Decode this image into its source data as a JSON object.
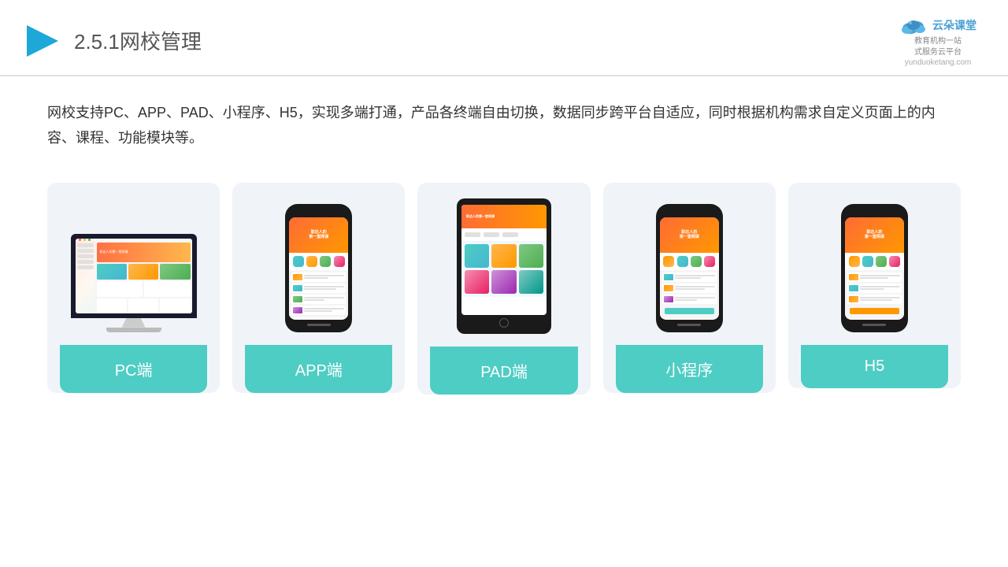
{
  "header": {
    "title_number": "2.5.1",
    "title_main": "网校管理",
    "logo_name": "云朵课堂",
    "logo_url": "yunduoketang.com",
    "logo_tagline": "教育机构一站\n式服务云平台"
  },
  "description": "网校支持PC、APP、PAD、小程序、H5，实现多端打通，产品各终端自由切换，数据同步跨平台自适应，同时根据机构需求自定义页面上的内容、课程、功能模块等。",
  "cards": [
    {
      "id": "pc",
      "label": "PC端"
    },
    {
      "id": "app",
      "label": "APP端"
    },
    {
      "id": "pad",
      "label": "PAD端"
    },
    {
      "id": "miniprogram",
      "label": "小程序"
    },
    {
      "id": "h5",
      "label": "H5"
    }
  ],
  "colors": {
    "teal": "#4ecdc4",
    "accent_orange": "#ff6b35",
    "bg_card": "#eef2f7",
    "header_border": "#e0e0e0"
  }
}
